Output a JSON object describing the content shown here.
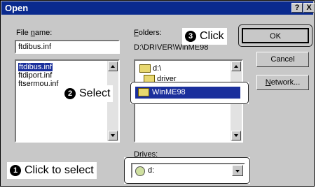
{
  "window": {
    "title": "Open",
    "help_label": "?",
    "close_label": "X"
  },
  "file_name": {
    "label_pre": "File ",
    "label_key": "n",
    "label_post": "ame:",
    "value": "ftdibus.inf",
    "files": [
      "ftdibus.inf",
      "ftdiport.inf",
      "ftsermou.inf"
    ]
  },
  "folders": {
    "label_key": "F",
    "label_post": "olders:",
    "path": "D:\\DRIVER\\WinME98",
    "tree": [
      "d:\\",
      "driver",
      "WinME98"
    ]
  },
  "drives": {
    "label": "Drives:",
    "value": "d:"
  },
  "buttons": {
    "ok": "OK",
    "cancel": "Cancel",
    "network_key": "N",
    "network_post": "etwork..."
  },
  "annotations": {
    "step1_num": "1",
    "step1_text": "Click to select",
    "step2_num": "2",
    "step2_text": "Select",
    "step3_num": "3",
    "step3_text": "Click"
  }
}
